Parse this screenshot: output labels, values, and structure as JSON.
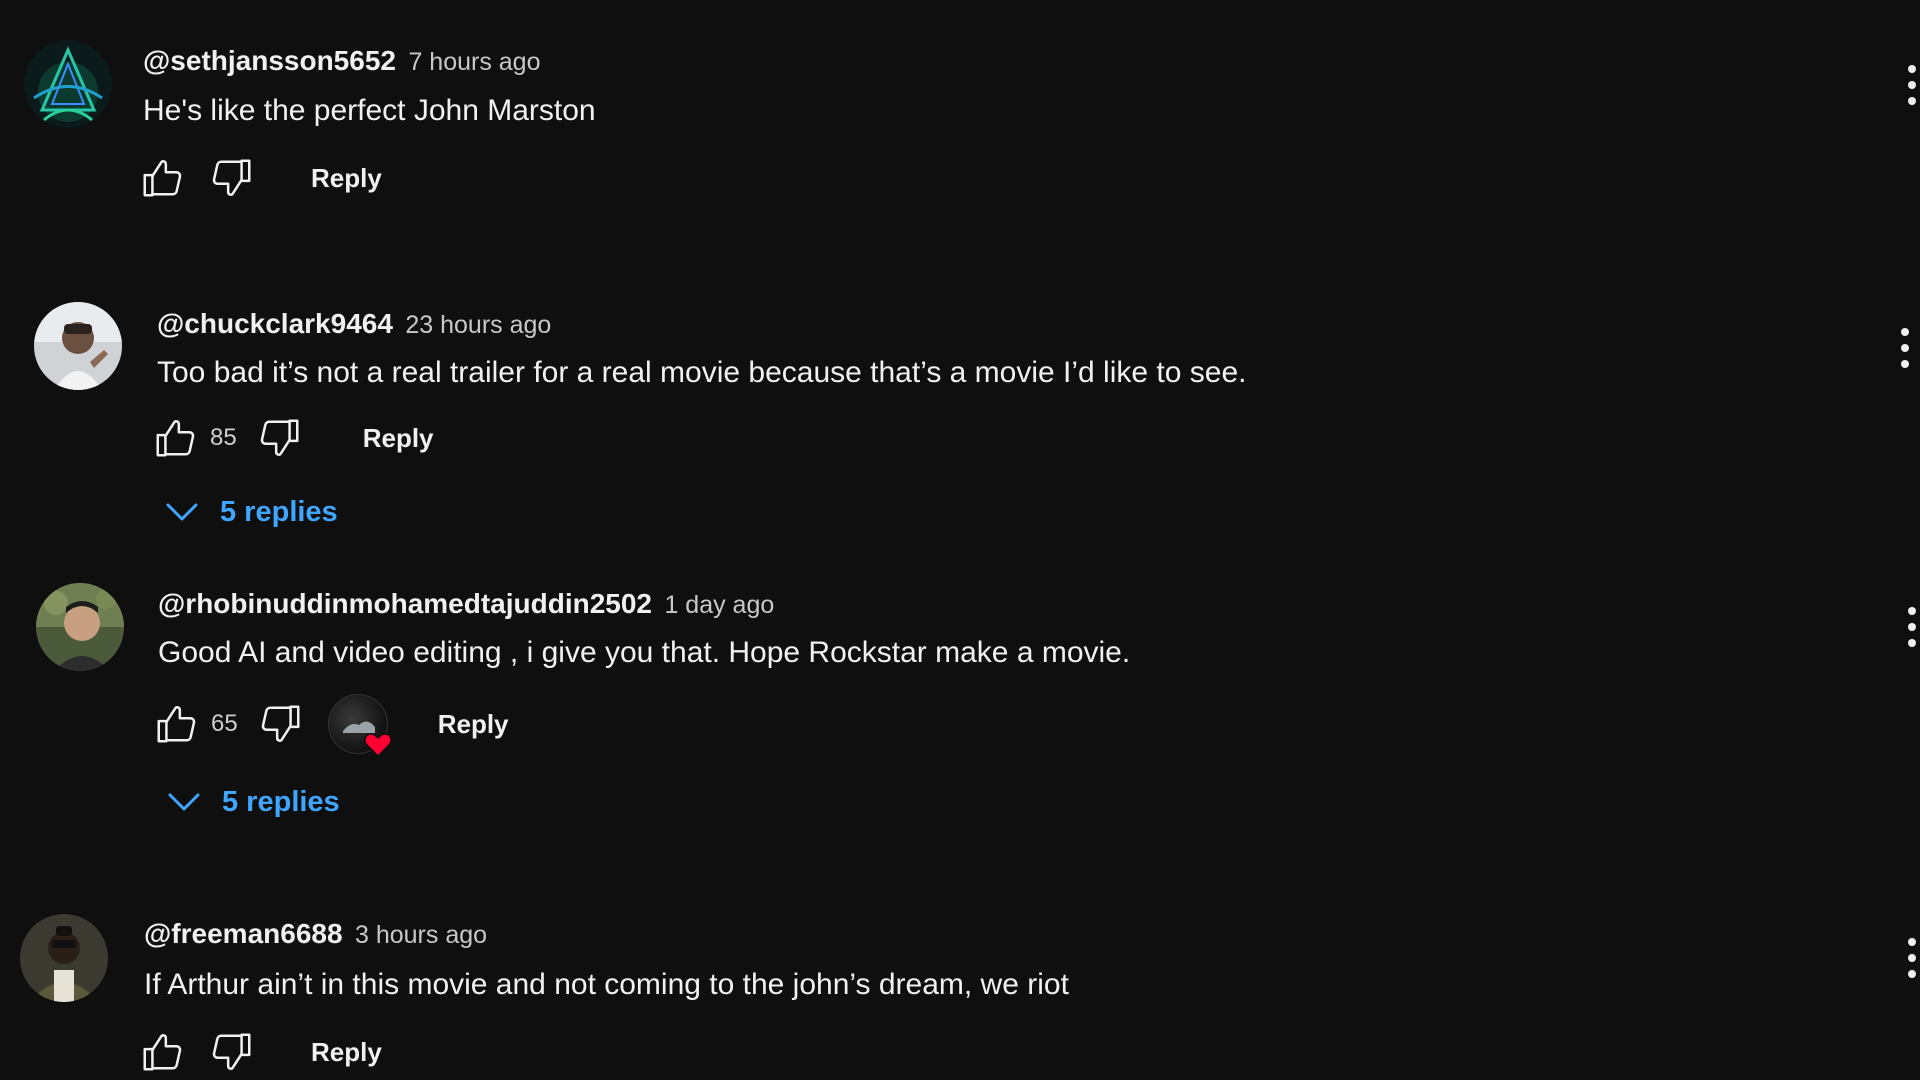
{
  "comments": [
    {
      "author": "@sethjansson5652",
      "time": "7 hours ago",
      "text": "He's like the perfect John Marston",
      "likes": "",
      "reply_label": "Reply",
      "replies_label": ""
    },
    {
      "author": "@chuckclark9464",
      "time": "23 hours ago",
      "text": "Too bad it’s not a real trailer for a real movie because that’s a movie I’d like to see.",
      "likes": "85",
      "reply_label": "Reply",
      "replies_label": "5 replies"
    },
    {
      "author": "@rhobinuddinmohamedtajuddin2502",
      "time": "1 day ago",
      "text": "Good AI and video editing , i give you that. Hope Rockstar make a movie.",
      "likes": "65",
      "reply_label": "Reply",
      "replies_label": "5 replies",
      "creator_hearted": true
    },
    {
      "author": "@freeman6688",
      "time": "3 hours ago",
      "text": "If Arthur ain’t in this movie and not coming to the john’s dream, we riot",
      "likes": "",
      "reply_label": "Reply",
      "replies_label": ""
    }
  ],
  "icons": {
    "like": "thumbs-up-icon",
    "dislike": "thumbs-down-icon",
    "more": "vertical-ellipsis-icon",
    "expand": "chevron-down-icon",
    "heart": "heart-icon"
  },
  "colors": {
    "background": "#0f0f0f",
    "link_blue": "#3ea6ff",
    "heart_red": "#ff0033"
  }
}
